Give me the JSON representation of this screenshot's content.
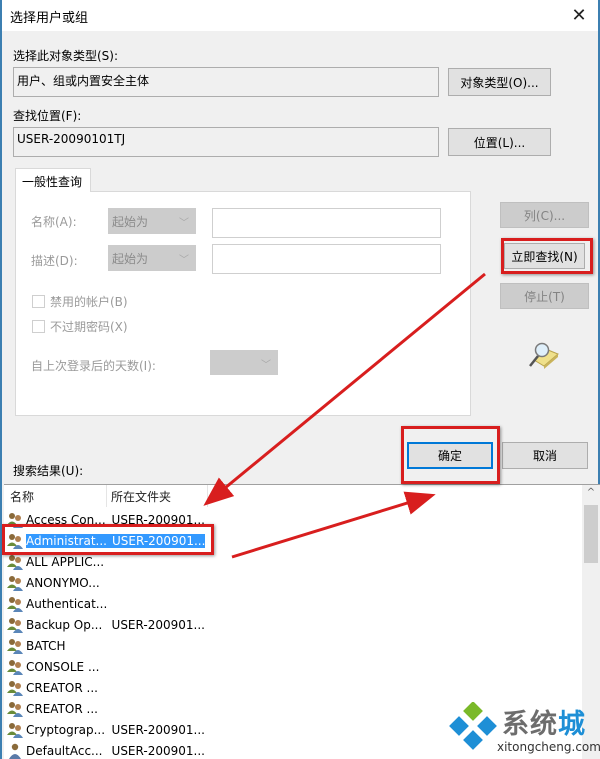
{
  "window": {
    "title": "选择用户或组",
    "close_glyph": "✕"
  },
  "object_type": {
    "label": "选择此对象类型(S):",
    "value": "用户、组或内置安全主体",
    "button": "对象类型(O)..."
  },
  "location": {
    "label": "查找位置(F):",
    "value": "USER-20090101TJ",
    "button": "位置(L)..."
  },
  "general_query": {
    "tab_label": "一般性查询",
    "name_label": "名称(A):",
    "name_mode": "起始为",
    "name_value": "",
    "desc_label": "描述(D):",
    "desc_mode": "起始为",
    "desc_value": "",
    "disabled_accounts_label": "禁用的帐户(B)",
    "non_expiring_pw_label": "不过期密码(X)",
    "days_since_login_label": "自上次登录后的天数(I):",
    "days_since_login_value": "",
    "chevron": "﹀"
  },
  "side_buttons": {
    "columns": "列(C)...",
    "find_now": "立即查找(N)",
    "stop": "停止(T)"
  },
  "dialog_buttons": {
    "ok": "确定",
    "cancel": "取消"
  },
  "results": {
    "label": "搜索结果(U):",
    "columns": [
      "名称",
      "所在文件夹"
    ],
    "rows": [
      {
        "name": "Access Con...",
        "folder": "USER-200901...",
        "icon": "group",
        "selected": false
      },
      {
        "name": "Administrat...",
        "folder": "USER-200901...",
        "icon": "group",
        "selected": true
      },
      {
        "name": "ALL APPLIC...",
        "folder": "",
        "icon": "group",
        "selected": false
      },
      {
        "name": "ANONYMO...",
        "folder": "",
        "icon": "group",
        "selected": false
      },
      {
        "name": "Authenticat...",
        "folder": "",
        "icon": "group",
        "selected": false
      },
      {
        "name": "Backup Op...",
        "folder": "USER-200901...",
        "icon": "group",
        "selected": false
      },
      {
        "name": "BATCH",
        "folder": "",
        "icon": "group",
        "selected": false
      },
      {
        "name": "CONSOLE ...",
        "folder": "",
        "icon": "group",
        "selected": false
      },
      {
        "name": "CREATOR ...",
        "folder": "",
        "icon": "group",
        "selected": false
      },
      {
        "name": "CREATOR ...",
        "folder": "",
        "icon": "group",
        "selected": false
      },
      {
        "name": "Cryptograp...",
        "folder": "USER-200901...",
        "icon": "group",
        "selected": false
      },
      {
        "name": "DefaultAcc...",
        "folder": "USER-200901...",
        "icon": "user",
        "selected": false
      }
    ],
    "scroll_up_glyph": "^"
  },
  "watermark": {
    "text_gray": "系统",
    "text_blue": "城",
    "url": "xitongcheng.com"
  },
  "colors": {
    "annotation_red": "#d81e1e",
    "selection_blue": "#3399ff",
    "default_button_border": "#0078d7",
    "window_border": "#3c7fb1"
  }
}
